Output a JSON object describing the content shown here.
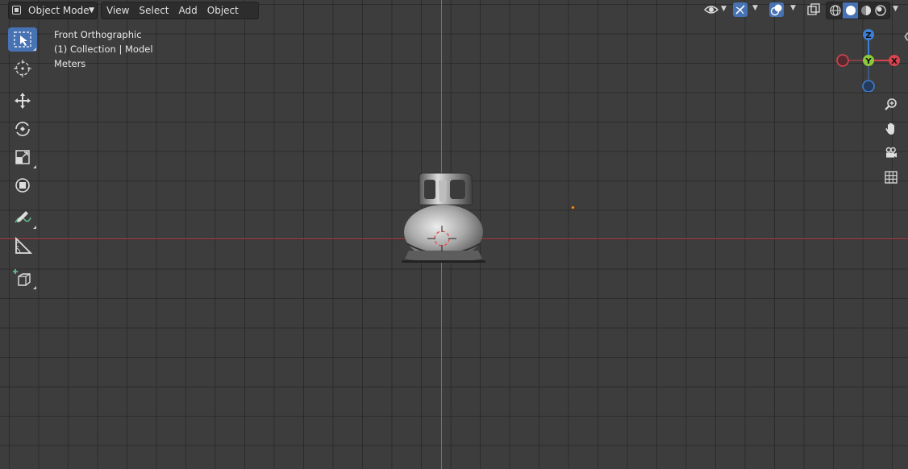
{
  "header": {
    "mode_label": "Object Mode",
    "menus": [
      "View",
      "Select",
      "Add",
      "Object"
    ]
  },
  "overlay": {
    "view_name": "Front Orthographic",
    "collection": "(1) Collection | Model",
    "units": "Meters"
  },
  "gizmo": {
    "z_label": "Z",
    "y_label": "Y",
    "x_label": "X",
    "colors": {
      "x": "#d9434f",
      "y": "#8cc83c",
      "z": "#3d7fd4"
    }
  },
  "toolbar": {
    "tools": [
      "select-box",
      "cursor",
      "move",
      "rotate",
      "scale",
      "transform",
      "annotate",
      "measure",
      "add-cube"
    ],
    "active": "select-box"
  },
  "navigation": [
    "zoom-icon",
    "pan-hand-icon",
    "camera-icon",
    "grid-icon"
  ],
  "shading": {
    "modes": [
      "wireframe",
      "solid",
      "material",
      "rendered"
    ],
    "active": "solid"
  },
  "colors": {
    "x_axis": "#b5404d",
    "z_axis": "#4a78b8",
    "accent": "#4772b3",
    "origin": "#e8942a"
  }
}
